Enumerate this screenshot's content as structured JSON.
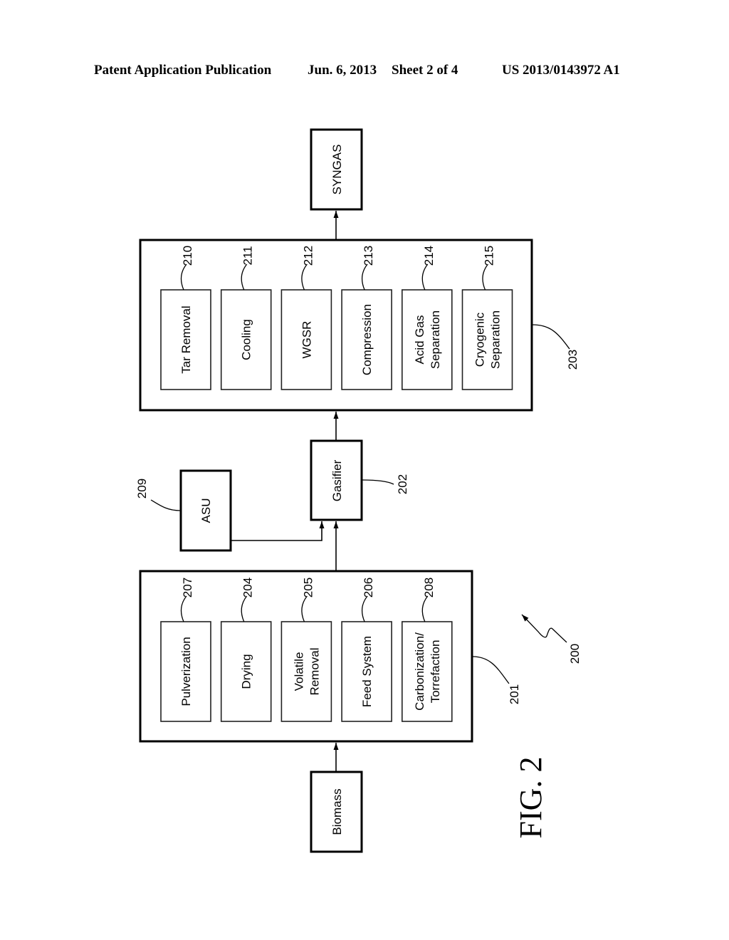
{
  "header": {
    "publication": "Patent Application Publication",
    "date": "Jun. 6, 2013",
    "sheet": "Sheet 2 of 4",
    "number": "US 2013/0143972 A1"
  },
  "figure": {
    "label": "FIG. 2",
    "system_ref": "200",
    "syngas": {
      "label": "SYNGAS"
    },
    "biomass": {
      "label": "Biomass"
    },
    "gasifier": {
      "label": "Gasifier",
      "ref": "202"
    },
    "asu": {
      "label": "ASU",
      "ref": "209"
    },
    "pretreatment": {
      "ref": "201",
      "steps": [
        {
          "label": "Pulverization",
          "ref": "207"
        },
        {
          "label": "Drying",
          "ref": "204"
        },
        {
          "label": "Volatile Removal",
          "lines": [
            "Volatile",
            "Removal"
          ],
          "ref": "205"
        },
        {
          "label": "Feed System",
          "ref": "206"
        },
        {
          "label": "Carbonization/ Torrefaction",
          "lines": [
            "Carbonization/",
            "Torrefaction"
          ],
          "ref": "208"
        }
      ]
    },
    "cleanup": {
      "ref": "203",
      "steps": [
        {
          "label": "Tar Removal",
          "ref": "210"
        },
        {
          "label": "Cooling",
          "ref": "211"
        },
        {
          "label": "WGSR",
          "ref": "212"
        },
        {
          "label": "Compression",
          "ref": "213"
        },
        {
          "label": "Acid Gas Separation",
          "lines": [
            "Acid Gas",
            "Separation"
          ],
          "ref": "214"
        },
        {
          "label": "Cryogenic Separation",
          "lines": [
            "Cryogenic",
            "Separation"
          ],
          "ref": "215"
        }
      ]
    }
  }
}
